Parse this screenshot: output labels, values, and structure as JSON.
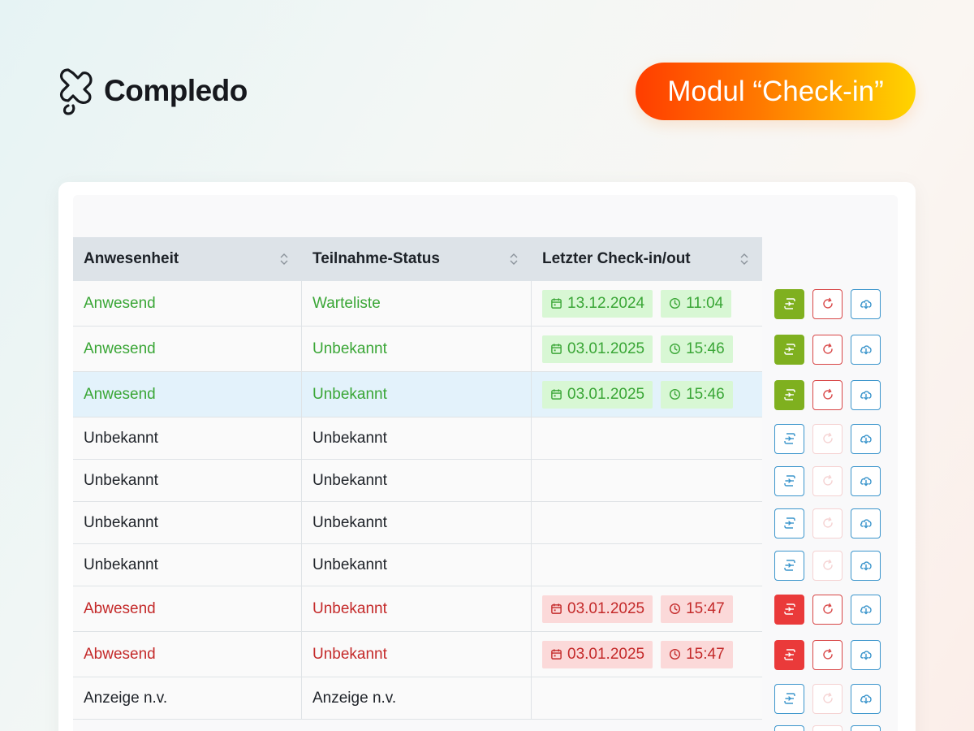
{
  "brand": {
    "name": "Compledo"
  },
  "badge": {
    "label": "Modul “Check-in”"
  },
  "table": {
    "headers": [
      "Anwesenheit",
      "Teilnahme-Status",
      "Letzter Check-in/out"
    ],
    "rows": [
      {
        "anwesenheit": "Anwesend",
        "status": "Warteliste",
        "date": "13.12.2024",
        "time": "11:04",
        "tone": "green",
        "highlight": false
      },
      {
        "anwesenheit": "Anwesend",
        "status": "Unbekannt",
        "date": "03.01.2025",
        "time": "15:46",
        "tone": "green",
        "highlight": false
      },
      {
        "anwesenheit": "Anwesend",
        "status": "Unbekannt",
        "date": "03.01.2025",
        "time": "15:46",
        "tone": "green",
        "highlight": true
      },
      {
        "anwesenheit": "Unbekannt",
        "status": "Unbekannt",
        "date": "",
        "time": "",
        "tone": "neutral",
        "highlight": false
      },
      {
        "anwesenheit": "Unbekannt",
        "status": "Unbekannt",
        "date": "",
        "time": "",
        "tone": "neutral",
        "highlight": false
      },
      {
        "anwesenheit": "Unbekannt",
        "status": "Unbekannt",
        "date": "",
        "time": "",
        "tone": "neutral",
        "highlight": false
      },
      {
        "anwesenheit": "Unbekannt",
        "status": "Unbekannt",
        "date": "",
        "time": "",
        "tone": "neutral",
        "highlight": false
      },
      {
        "anwesenheit": "Abwesend",
        "status": "Unbekannt",
        "date": "03.01.2025",
        "time": "15:47",
        "tone": "red",
        "highlight": false
      },
      {
        "anwesenheit": "Abwesend",
        "status": "Unbekannt",
        "date": "03.01.2025",
        "time": "15:47",
        "tone": "red",
        "highlight": false
      },
      {
        "anwesenheit": "Anzeige n.v.",
        "status": "Anzeige n.v.",
        "date": "",
        "time": "",
        "tone": "neutral",
        "highlight": false
      }
    ]
  },
  "icons": {
    "checkin": "check-in-out-icon",
    "reset": "reset-icon",
    "download": "cloud-download-icon",
    "date": "calendar-icon",
    "time": "clock-icon",
    "sort": "sort-icon"
  },
  "colors": {
    "green_text": "#3aa636",
    "green_chip": "#d8f7d4",
    "red_text": "#c42a2a",
    "red_chip": "#fbd9d9",
    "checkin_green": "#7fb01f",
    "checkin_red": "#ea3a3a",
    "blue_outline": "#3b95cc",
    "header_bg": "#dde3e8",
    "highlight_row": "#e3f2fb"
  }
}
